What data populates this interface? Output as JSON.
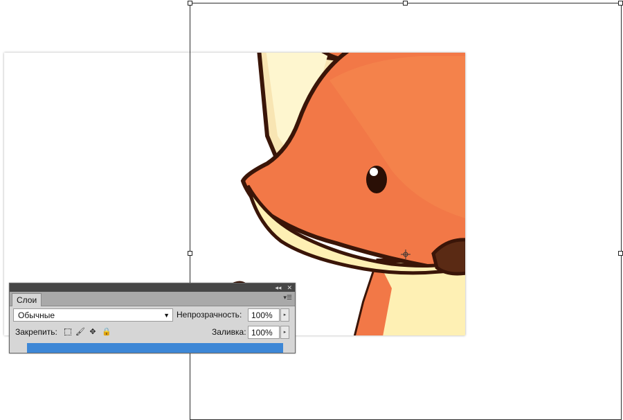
{
  "layers_panel": {
    "collapse_label": "◂◂",
    "close_label": "✕",
    "tab_label": "Слои",
    "menu_label": "▾☰",
    "blend_mode": "Обычные",
    "opacity_label": "Непрозрачность:",
    "opacity_value": "100%",
    "lock_label": "Закрепить:",
    "fill_label": "Заливка:",
    "fill_value": "100%"
  },
  "icons": [
    "pivot-crosshair-icon",
    "dropdown-arrow-icon",
    "stepper-arrow-icon",
    "lock-transparent-icon",
    "lock-brush-icon",
    "lock-move-icon",
    "lock-all-icon"
  ],
  "colors": {
    "fox_orange": "#f27847",
    "fox_dark": "#3a1508",
    "fox_cream": "#fef0b4",
    "selected_layer": "#3d87d6"
  }
}
